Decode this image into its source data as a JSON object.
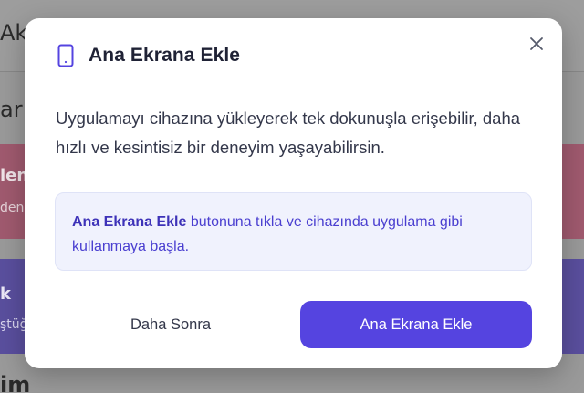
{
  "background": {
    "header_text": "Ak",
    "section_title": "ar",
    "pink_card": {
      "title": "len",
      "subtitle": "den"
    },
    "purple_card": {
      "title": "k",
      "subtitle": "ştüğ"
    },
    "bottom_text": "im"
  },
  "modal": {
    "icon": "phone-icon",
    "title": "Ana Ekrana Ekle",
    "close_icon": "close-icon",
    "description": "Uygulamayı cihazına yükleyerek tek dokunuşla erişebilir, daha hızlı ve kesintisiz bir deneyim yaşayabilirsin.",
    "info": {
      "highlight": "Ana Ekrana Ekle",
      "text": " butonuna tıkla ve cihazında uygulama gibi kullanmaya başla."
    },
    "secondary_button": "Daha Sonra",
    "primary_button": "Ana Ekrana Ekle"
  },
  "colors": {
    "accent": "#5544e0",
    "info_bg": "#f0f2fd",
    "info_text": "#4a3fd0",
    "title": "#1f2235"
  }
}
